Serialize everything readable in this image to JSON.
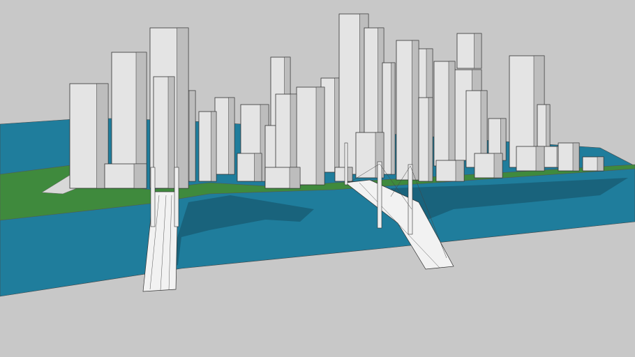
{
  "scene": {
    "colors": {
      "sky": "#c8c8c8",
      "ground": "#c6c6c6",
      "water": "#1f7d9c",
      "water_shadow": "#185d74",
      "grass": "#3f8a3d",
      "building": "#e4e4e4",
      "building_dark": "#bdbdbd",
      "outline": "#333333",
      "deck": "#f2f2f2"
    }
  }
}
